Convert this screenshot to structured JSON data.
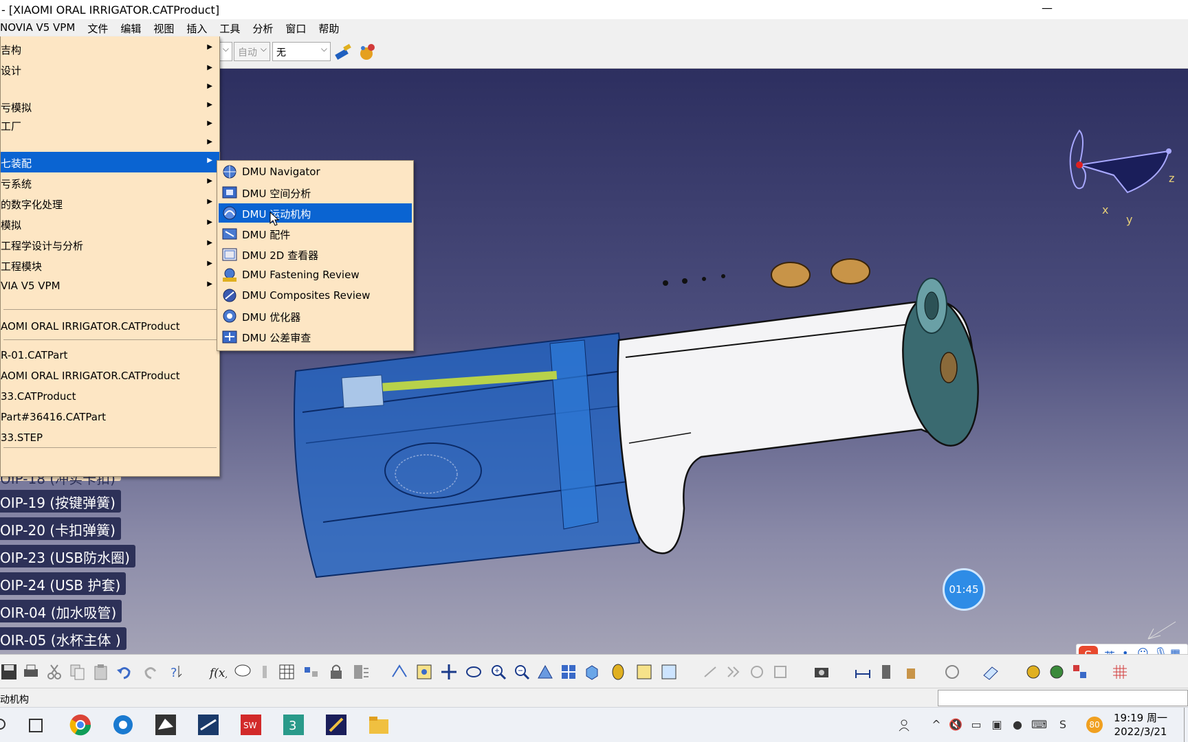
{
  "window": {
    "title": "- [XIAOMI ORAL IRRIGATOR.CATProduct]",
    "minimize_glyph": "—"
  },
  "menubar": {
    "items": [
      "NOVIA V5 VPM",
      "文件",
      "编辑",
      "视图",
      "插入",
      "工具",
      "分析",
      "窗口",
      "帮助"
    ]
  },
  "toolbar_top": {
    "combo1_value": "自动",
    "combo2_value": "无"
  },
  "start_menu": {
    "items": [
      {
        "label": "吉构",
        "has_submenu": true
      },
      {
        "label": "设计",
        "has_submenu": true
      },
      {
        "label": "",
        "has_submenu": true
      },
      {
        "label": "亏模拟",
        "has_submenu": true
      },
      {
        "label": "工厂",
        "has_submenu": true
      },
      {
        "label": "",
        "has_submenu": true
      },
      {
        "label": "七装配",
        "has_submenu": true,
        "active": true
      },
      {
        "label": "亏系统",
        "has_submenu": true
      },
      {
        "label": "的数字化处理",
        "has_submenu": true
      },
      {
        "label": "模拟",
        "has_submenu": true
      },
      {
        "label": "工程学设计与分析",
        "has_submenu": true
      },
      {
        "label": "工程模块",
        "has_submenu": true
      },
      {
        "label": "VIA V5 VPM",
        "has_submenu": true
      }
    ],
    "recent_current": "AOMI ORAL IRRIGATOR.CATProduct",
    "recent_files": [
      "R-01.CATPart",
      "AOMI ORAL IRRIGATOR.CATProduct",
      "33.CATProduct",
      "Part#36416.CATPart",
      "33.STEP"
    ]
  },
  "submenu": {
    "items": [
      {
        "label": "DMU Navigator",
        "icon": "dmu-navigator-icon"
      },
      {
        "label": "DMU 空间分析",
        "icon": "dmu-space-analysis-icon"
      },
      {
        "label": "DMU 运动机构",
        "icon": "dmu-kinematics-icon",
        "active": true
      },
      {
        "label": "DMU 配件",
        "icon": "dmu-fitting-icon"
      },
      {
        "label": "DMU 2D 查看器",
        "icon": "dmu-2d-viewer-icon"
      },
      {
        "label": "DMU Fastening Review",
        "icon": "dmu-fastening-icon"
      },
      {
        "label": "DMU Composites Review",
        "icon": "dmu-composites-icon"
      },
      {
        "label": "DMU 优化器",
        "icon": "dmu-optimizer-icon"
      },
      {
        "label": "DMU 公差审查",
        "icon": "dmu-tolerance-icon"
      }
    ]
  },
  "tree": {
    "partial_label": "OIP-18 (冲实卡扣)",
    "labels": [
      "OIP-19 (按键弹簧)",
      "OIP-20 (卡扣弹簧)",
      "OIP-23 (USB防水圈)",
      "OIP-24 (USB 护套)",
      "OIR-04 (加水吸管)",
      "OIR-05 (水杯主体 )"
    ]
  },
  "compass": {
    "x_label": "x",
    "y_label": "y",
    "z_label": "z"
  },
  "timer": {
    "value": "01:45"
  },
  "statusbar": {
    "text": "动机构"
  },
  "ime": {
    "lang": "英"
  },
  "taskbar": {
    "time": "19:19 周一",
    "date": "2022/3/21",
    "badge": "80"
  },
  "colors": {
    "menu_bg": "#fde6c4",
    "menu_highlight": "#0a64d2",
    "viewport_top": "#2d2f60",
    "viewport_bottom": "#a4a3b6"
  }
}
